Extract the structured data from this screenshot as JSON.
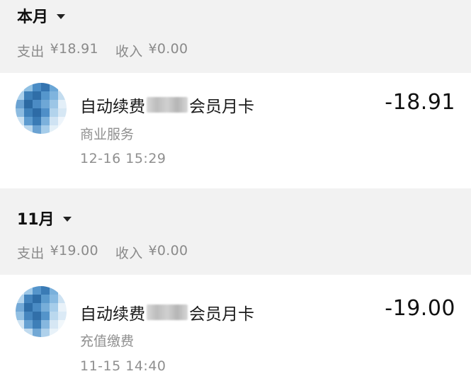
{
  "months": [
    {
      "title": "本月",
      "expense_label": "支出",
      "expense_value": "¥18.91",
      "income_label": "收入",
      "income_value": "¥0.00",
      "transaction": {
        "title_prefix": "自动续费",
        "title_suffix": "会员月卡",
        "category": "商业服务",
        "time": "12-16  15:29",
        "amount": "-18.91"
      }
    },
    {
      "title": "11月",
      "expense_label": "支出",
      "expense_value": "¥19.00",
      "income_label": "收入",
      "income_value": "¥0.00",
      "transaction": {
        "title_prefix": "自动续费",
        "title_suffix": "会员月卡",
        "category": "充值缴费",
        "time": "11-15  14:40",
        "amount": "-19.00"
      }
    }
  ],
  "colors": {
    "background": "#f2f2f2",
    "card": "#ffffff",
    "muted_text": "#8f8f8f",
    "avatar_blue": "#3d7fb8"
  },
  "icons": {
    "month_dropdown": "caret-down-icon",
    "merchant_avatar": "pixelated-avatar"
  }
}
